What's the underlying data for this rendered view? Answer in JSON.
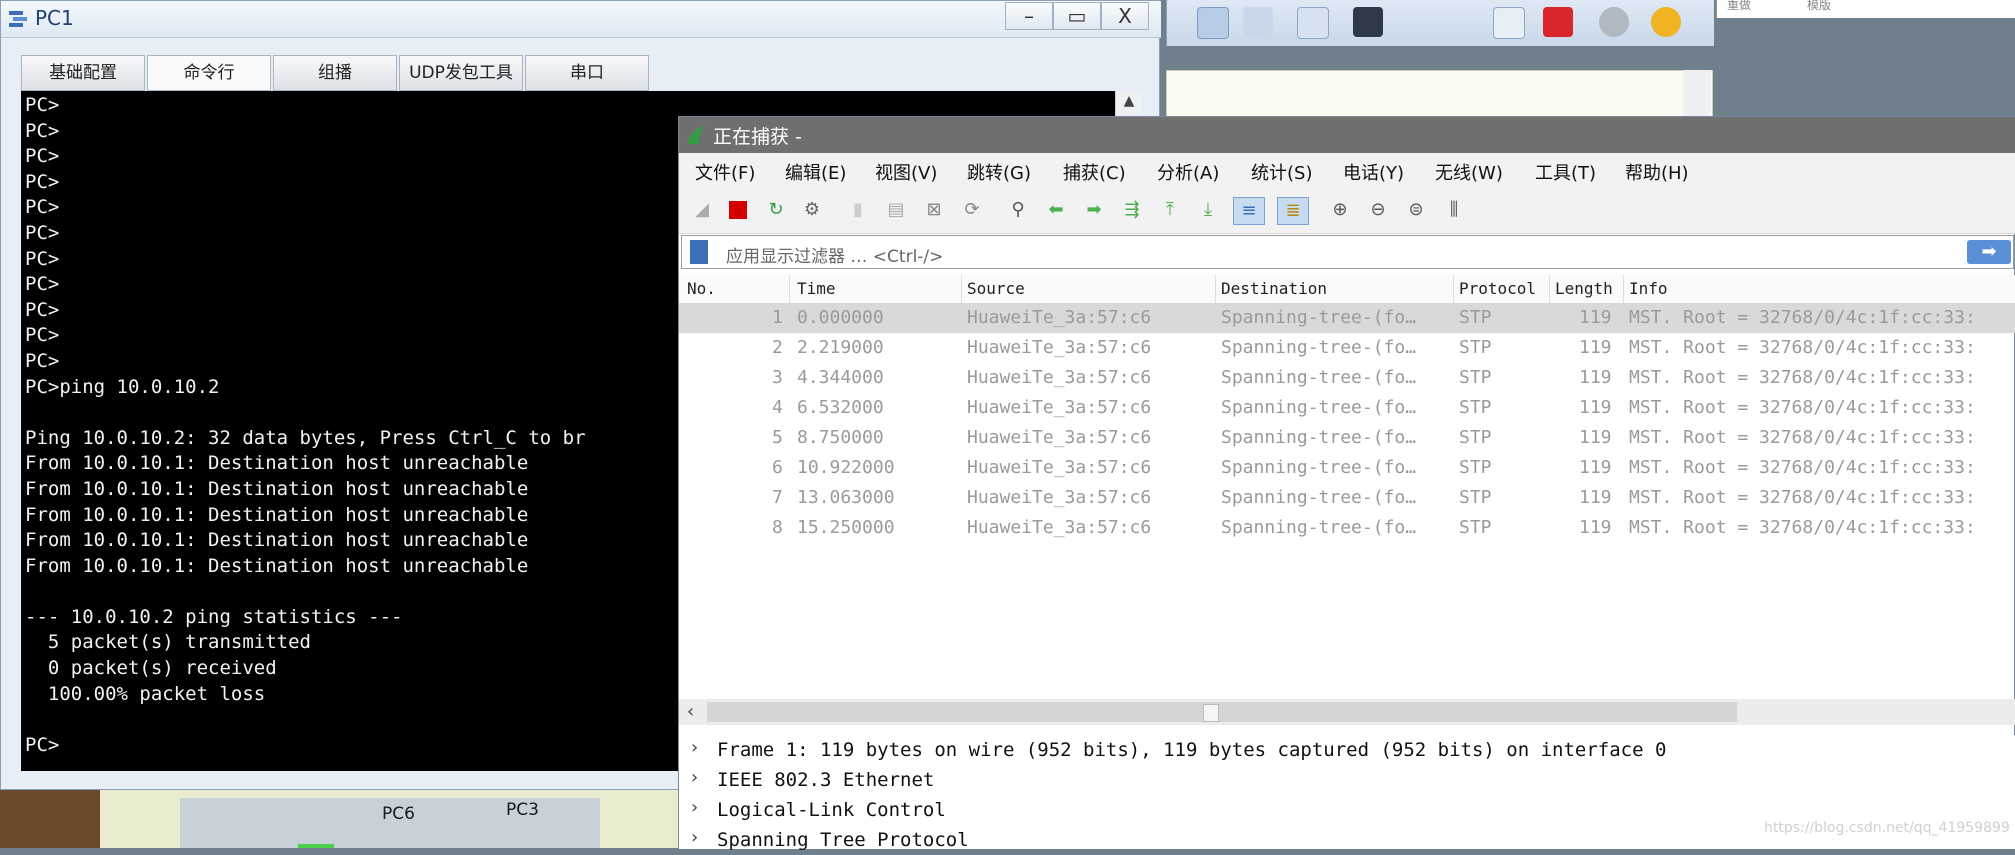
{
  "pc1": {
    "title": "PC1",
    "buttons": {
      "minimize": "–",
      "maximize": "▭",
      "close": "X"
    },
    "tabs": [
      "基础配置",
      "命令行",
      "组播",
      "UDP发包工具",
      "串口"
    ],
    "terminal_text": "PC>\nPC>\nPC>\nPC>\nPC>\nPC>\nPC>\nPC>\nPC>\nPC>\nPC>\nPC>ping 10.0.10.2\n\nPing 10.0.10.2: 32 data bytes, Press Ctrl_C to br\nFrom 10.0.10.1: Destination host unreachable\nFrom 10.0.10.1: Destination host unreachable\nFrom 10.0.10.1: Destination host unreachable\nFrom 10.0.10.1: Destination host unreachable\nFrom 10.0.10.1: Destination host unreachable\n\n--- 10.0.10.2 ping statistics ---\n  5 packet(s) transmitted\n  0 packet(s) received\n  100.00% packet loss\n\nPC>"
  },
  "ensp": {
    "device_labels": [
      "PC6",
      "PC3"
    ],
    "right_panel": {
      "left_label": "重做",
      "right_label": "模版"
    }
  },
  "wireshark": {
    "title": "正在捕获 -",
    "menu": [
      "文件(F)",
      "编辑(E)",
      "视图(V)",
      "跳转(G)",
      "捕获(C)",
      "分析(A)",
      "统计(S)",
      "电话(Y)",
      "无线(W)",
      "工具(T)",
      "帮助(H)"
    ],
    "filter_placeholder": "应用显示过滤器 … <Ctrl-/>",
    "columns": [
      "No.",
      "Time",
      "Source",
      "Destination",
      "Protocol",
      "Length",
      "Info"
    ],
    "packets": [
      {
        "no": "1",
        "time": "0.000000",
        "source": "HuaweiTe_3a:57:c6",
        "destination": "Spanning-tree-(fo…",
        "protocol": "STP",
        "length": "119",
        "info": "MST. Root = 32768/0/4c:1f:cc:33:"
      },
      {
        "no": "2",
        "time": "2.219000",
        "source": "HuaweiTe_3a:57:c6",
        "destination": "Spanning-tree-(fo…",
        "protocol": "STP",
        "length": "119",
        "info": "MST. Root = 32768/0/4c:1f:cc:33:"
      },
      {
        "no": "3",
        "time": "4.344000",
        "source": "HuaweiTe_3a:57:c6",
        "destination": "Spanning-tree-(fo…",
        "protocol": "STP",
        "length": "119",
        "info": "MST. Root = 32768/0/4c:1f:cc:33:"
      },
      {
        "no": "4",
        "time": "6.532000",
        "source": "HuaweiTe_3a:57:c6",
        "destination": "Spanning-tree-(fo…",
        "protocol": "STP",
        "length": "119",
        "info": "MST. Root = 32768/0/4c:1f:cc:33:"
      },
      {
        "no": "5",
        "time": "8.750000",
        "source": "HuaweiTe_3a:57:c6",
        "destination": "Spanning-tree-(fo…",
        "protocol": "STP",
        "length": "119",
        "info": "MST. Root = 32768/0/4c:1f:cc:33:"
      },
      {
        "no": "6",
        "time": "10.922000",
        "source": "HuaweiTe_3a:57:c6",
        "destination": "Spanning-tree-(fo…",
        "protocol": "STP",
        "length": "119",
        "info": "MST. Root = 32768/0/4c:1f:cc:33:"
      },
      {
        "no": "7",
        "time": "13.063000",
        "source": "HuaweiTe_3a:57:c6",
        "destination": "Spanning-tree-(fo…",
        "protocol": "STP",
        "length": "119",
        "info": "MST. Root = 32768/0/4c:1f:cc:33:"
      },
      {
        "no": "8",
        "time": "15.250000",
        "source": "HuaweiTe_3a:57:c6",
        "destination": "Spanning-tree-(fo…",
        "protocol": "STP",
        "length": "119",
        "info": "MST. Root = 32768/0/4c:1f:cc:33:"
      }
    ],
    "details": [
      "Frame 1: 119 bytes on wire (952 bits), 119 bytes captured (952 bits) on interface 0",
      "IEEE 802.3 Ethernet",
      "Logical-Link Control",
      "Spanning Tree Protocol"
    ]
  },
  "watermark": "https://blog.csdn.net/qq_41959899",
  "colors": {
    "terminal_bg": "#000000",
    "terminal_fg": "#f2f2f2",
    "ws_title_bg": "#6f6f6f",
    "selected_row": "#d9d9d9",
    "capture_stop": "#d40000"
  }
}
